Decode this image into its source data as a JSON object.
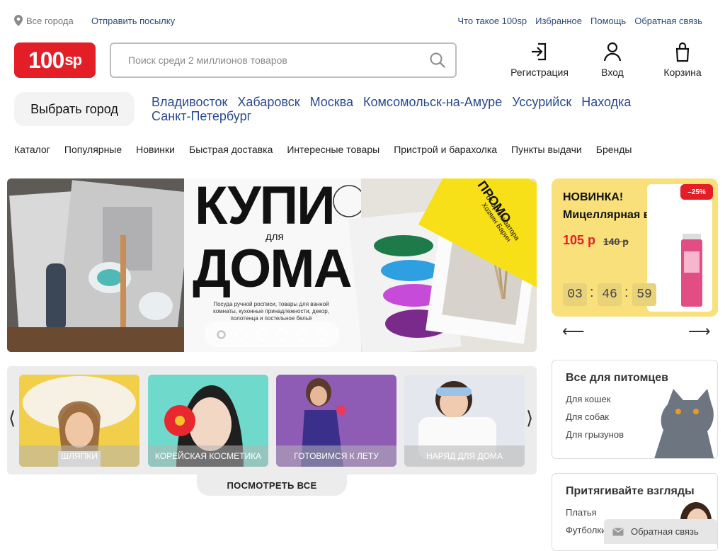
{
  "topbar": {
    "city": "Все города",
    "send": "Отправить посылку",
    "links": [
      "Что такое 100sp",
      "Избранное",
      "Помощь",
      "Обратная связь"
    ]
  },
  "header": {
    "logo": "100sp",
    "search_placeholder": "Поиск среди 2 миллионов товаров",
    "register": "Регистрация",
    "login": "Вход",
    "cart": "Корзина"
  },
  "cities": {
    "choose": "Выбрать город",
    "list": [
      "Владивосток",
      "Хабаровск",
      "Москва",
      "Комсомольск-на-Амуре",
      "Уссурийск",
      "Находка",
      "Санкт-Петербург"
    ]
  },
  "nav": [
    "Каталог",
    "Популярные",
    "Новинки",
    "Быстрая доставка",
    "Интересные товары",
    "Пристрой и барахолка",
    "Пункты выдачи",
    "Бренды"
  ],
  "banner": {
    "title1": "КУПИ",
    "for": "для",
    "title2": "ДОМА",
    "desc": "Посуда ручной росписи, товары для ванной комнаты, кухонные принадлежности, декор, полотенца и постельное бельё",
    "promo": "ПРОМО",
    "promo_sub": "от организатора Хозяин Барин",
    "slides": 6,
    "active_slide": 1
  },
  "deal": {
    "badge": "–25%",
    "new": "НОВИНКА!",
    "name": "Мицеллярная вода",
    "price": "105 р",
    "old_price": "140 р",
    "timer": [
      "03",
      "46",
      "59"
    ]
  },
  "categories": {
    "items": [
      "Шляпки",
      "Корейская косметика",
      "Готовимся к лету",
      "Наряд для дома"
    ],
    "see_all": "ПОСМОТРЕТЬ ВСЕ"
  },
  "pets": {
    "title": "Все для питомцев",
    "links": [
      "Для кошек",
      "Для собак",
      "Для грызунов"
    ]
  },
  "fashion": {
    "title": "Притягивайте взгляды",
    "links": [
      "Платья",
      "Футболки"
    ]
  },
  "feedback": "Обратная связь",
  "colors": {
    "brand": "#e41e26",
    "link": "#2b4a8e",
    "deal_bg": "#f9e07a",
    "promo": "#f8e018"
  }
}
